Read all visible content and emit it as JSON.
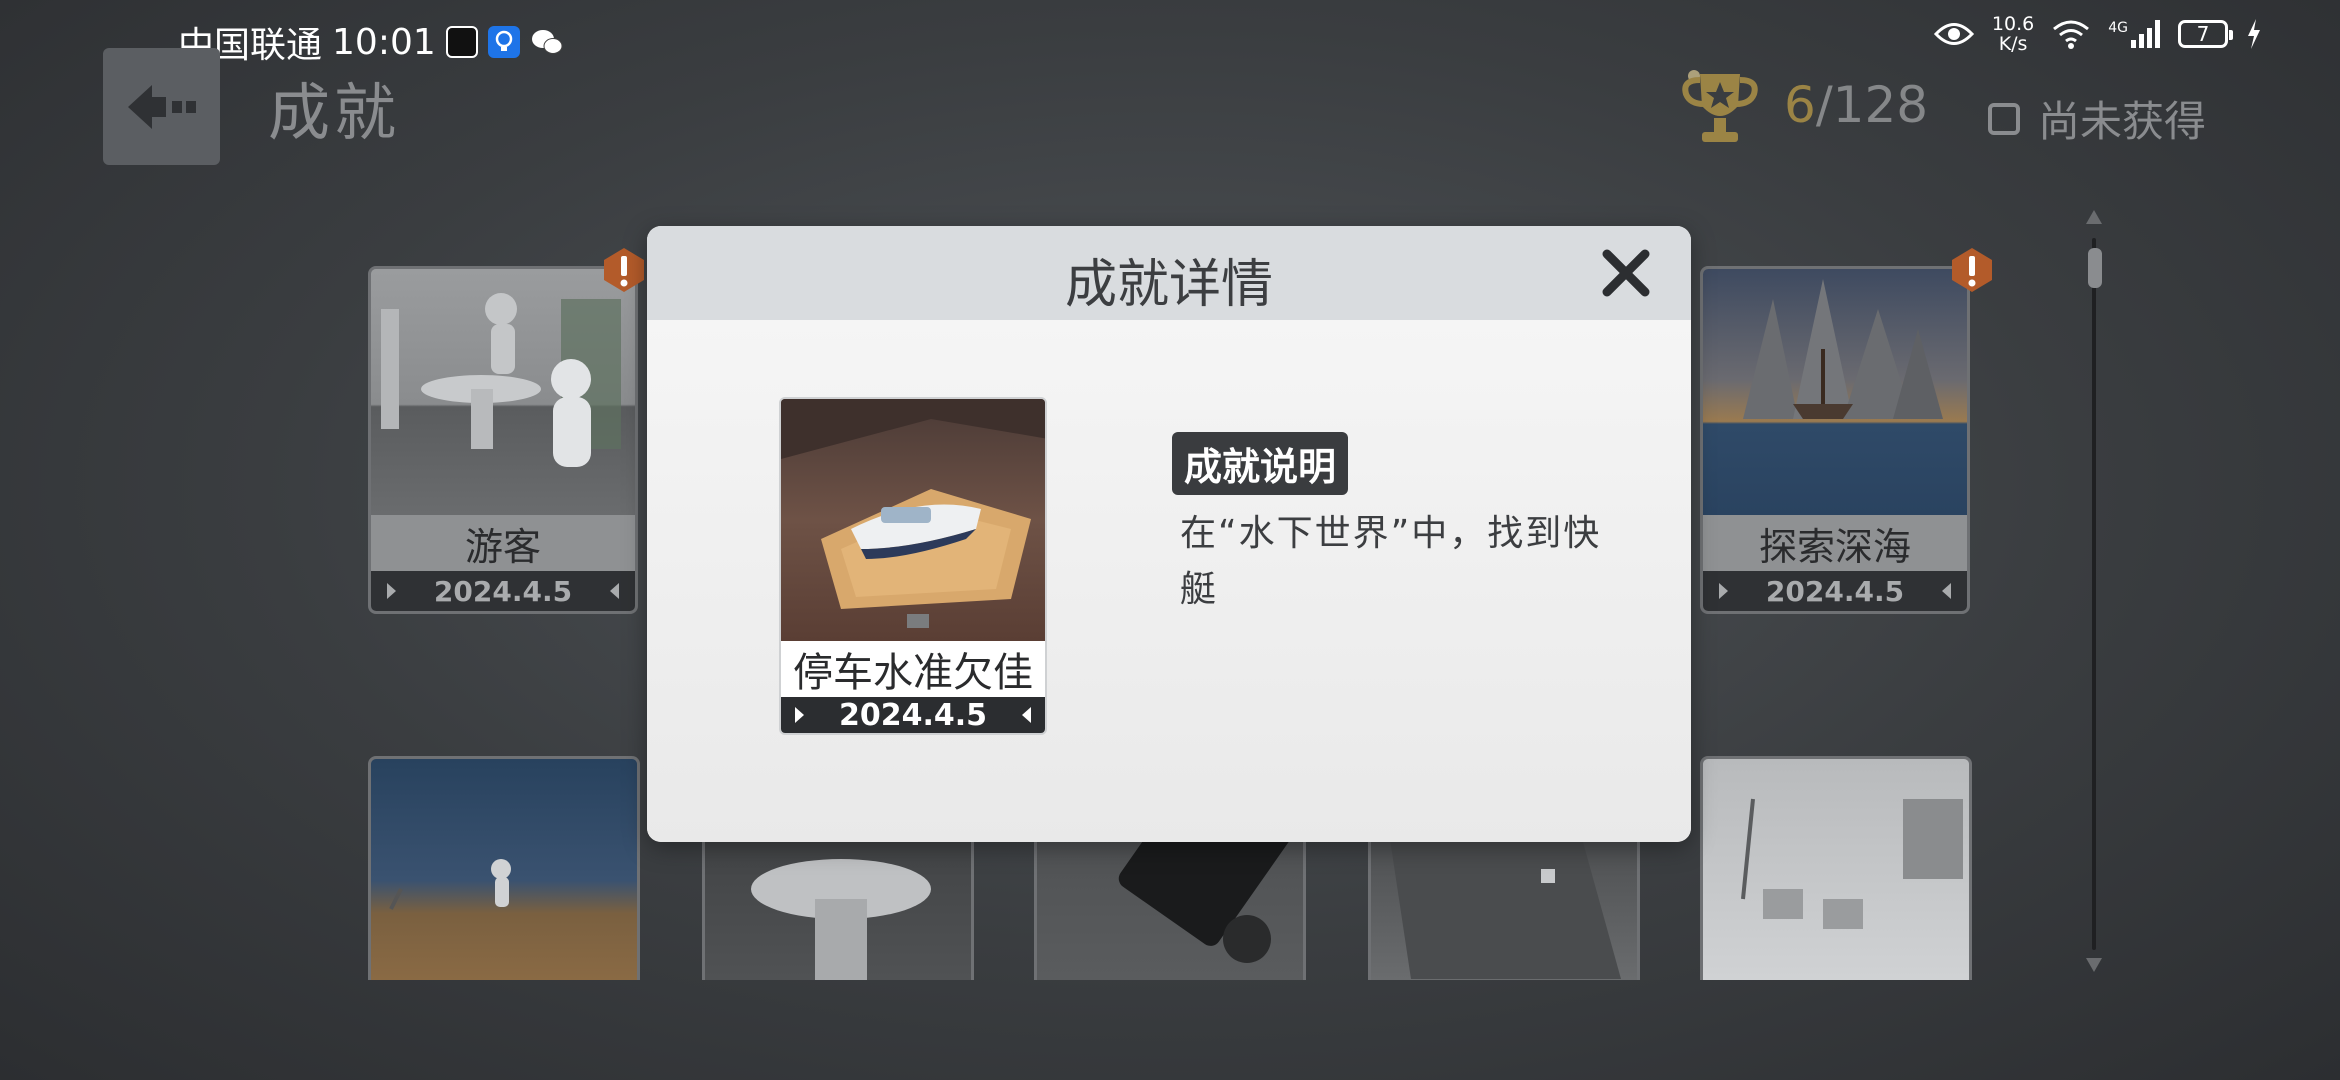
{
  "status_bar": {
    "carrier": "中国联通",
    "time": "10:01",
    "net_speed_value": "10.6",
    "net_speed_unit": "K/s",
    "network_type": "4G",
    "battery_level": "7"
  },
  "header": {
    "title": "成就",
    "earned_count": "6",
    "total_count": "/128",
    "unearned_filter_label": "尚未获得"
  },
  "achievements": [
    {
      "name": "游客",
      "date": "2024.4.5"
    },
    {
      "name": "探索深海",
      "date": "2024.4.5"
    }
  ],
  "dialog": {
    "title": "成就详情",
    "achievement_name": "停车水准欠佳",
    "achievement_date": "2024.4.5",
    "description_tag": "成就说明",
    "description": "在“水下世界”中，找到快艇"
  }
}
